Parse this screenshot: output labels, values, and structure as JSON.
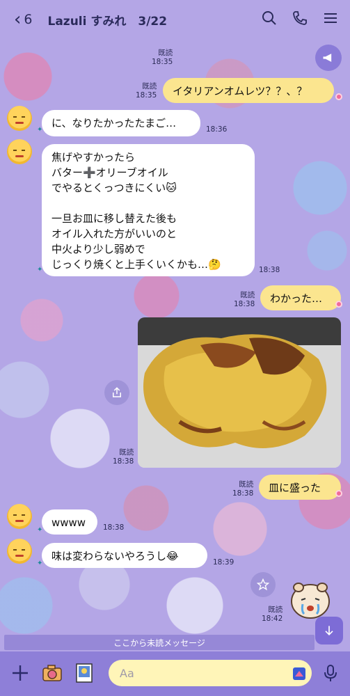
{
  "header": {
    "back_count": "6",
    "title": "Lazuli すみれ　3/22"
  },
  "messages": [
    {
      "side": "out",
      "text": "イタリアンオムレツ？？、？",
      "read": "既読",
      "time": "18:35"
    },
    {
      "side": "in",
      "text": "に、なりたかったたまご…",
      "time": "18:36"
    },
    {
      "side": "in",
      "text": "焦げやすかったら\nバター➕オリーブオイル\nでやるとくっつきにくい🐱\n\n一旦お皿に移し替えた後も\nオイル入れた方がいいのと\n中火より少し弱めで\nじっくり焼くと上手くいくかも…🤔",
      "time": "18:38"
    },
    {
      "side": "out",
      "text": "わかった…",
      "read": "既読",
      "time": "18:38"
    },
    {
      "side": "out",
      "type": "photo",
      "read": "既読",
      "time": "18:38"
    },
    {
      "side": "out",
      "text": "皿に盛った",
      "read": "既読",
      "time": "18:38"
    },
    {
      "side": "in",
      "text": "wwww",
      "time": "18:38"
    },
    {
      "side": "in",
      "text": "味は変わらないやろうし😂",
      "time": "18:39"
    },
    {
      "side": "out",
      "type": "sticker",
      "read": "既読",
      "time": "18:42"
    }
  ],
  "top_read": {
    "read": "既読",
    "time": "18:35"
  },
  "unread_banner": "ここから未読メッセージ",
  "input": {
    "placeholder": "Aa"
  },
  "colors": {
    "outgoing": "#fbe58f",
    "incoming": "#ffffff",
    "bar": "#8e7fd8",
    "accent": "#7d6cd6"
  }
}
